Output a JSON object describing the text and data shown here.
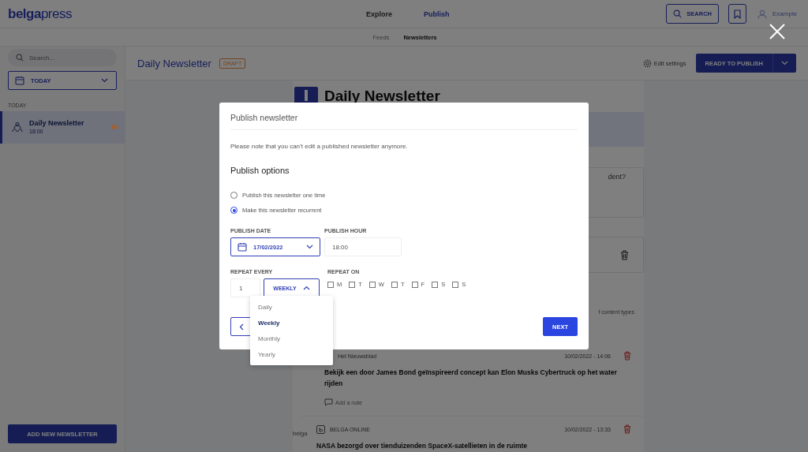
{
  "header": {
    "logo": "**belga**press",
    "nav": [
      {
        "label": "Explore",
        "selected": false
      },
      {
        "label": "Publish",
        "selected": true
      }
    ],
    "search_button": "SEARCH",
    "user": "Example"
  },
  "subnav": [
    {
      "label": "Feeds",
      "selected": false
    },
    {
      "label": "Newsletters",
      "selected": true
    }
  ],
  "sidebar": {
    "search": {
      "placeholder": "Search..."
    },
    "filter": "TODAY",
    "section": "TODAY",
    "items": [
      {
        "title": "Daily Newsletter",
        "time": "18:00",
        "selected": true,
        "color": "#a65f2a"
      }
    ],
    "add_button": "ADD NEW NEWSLETTER"
  },
  "main": {
    "title": "Daily Newsletter",
    "badge": "DRAFT",
    "edit_settings": "Edit settings",
    "publish_button": "READY TO PUBLISH",
    "heading": "Daily Newsletter",
    "question_fragment": "dent?",
    "types_fragment": "f content types",
    "articles": [
      {
        "source": "Het Nieuwsblad",
        "date": "10/02/2022 - 14:06",
        "title": "Bekijk een door James Bond geïnspireerd concept kan Elon Musks Cybertruck op het water rijden",
        "note": "Add a note"
      },
      {
        "logo": "belga",
        "source": "BELGA ONLINE",
        "date": "10/02/2022 - 13:33",
        "title": "NASA bezorgd over tienduizenden SpaceX-satellieten in de ruimte"
      }
    ]
  },
  "modal": {
    "title": "Publish newsletter",
    "note": "Please note that you can’t edit a published newsletter anymore.",
    "section": "Publish options",
    "options": [
      {
        "label": "Publish this newsletter one time",
        "selected": false
      },
      {
        "label": "Make this newsletter recurrent",
        "selected": true
      }
    ],
    "date_label": "PUBLISH DATE",
    "date": "17/02/2022",
    "hour_label": "PUBLISH HOUR",
    "hour": "18:00",
    "repeat_label": "REPEAT EVERY",
    "repeat_count": "1",
    "repeat_unit": {
      "value": "WEEKLY",
      "expanded": true
    },
    "repeat_on_label": "REPEAT ON",
    "days": [
      {
        "label": "M",
        "checked": false
      },
      {
        "label": "T",
        "checked": false
      },
      {
        "label": "W",
        "checked": false
      },
      {
        "label": "T",
        "checked": false
      },
      {
        "label": "F",
        "checked": false
      },
      {
        "label": "S",
        "checked": false
      },
      {
        "label": "S",
        "checked": false
      }
    ],
    "next_button": "NEXT",
    "menu": [
      {
        "label": "Daily",
        "selected": false
      },
      {
        "label": "Weekly",
        "selected": true
      },
      {
        "label": "Monthly",
        "selected": false
      },
      {
        "label": "Yearly",
        "selected": false
      }
    ]
  }
}
